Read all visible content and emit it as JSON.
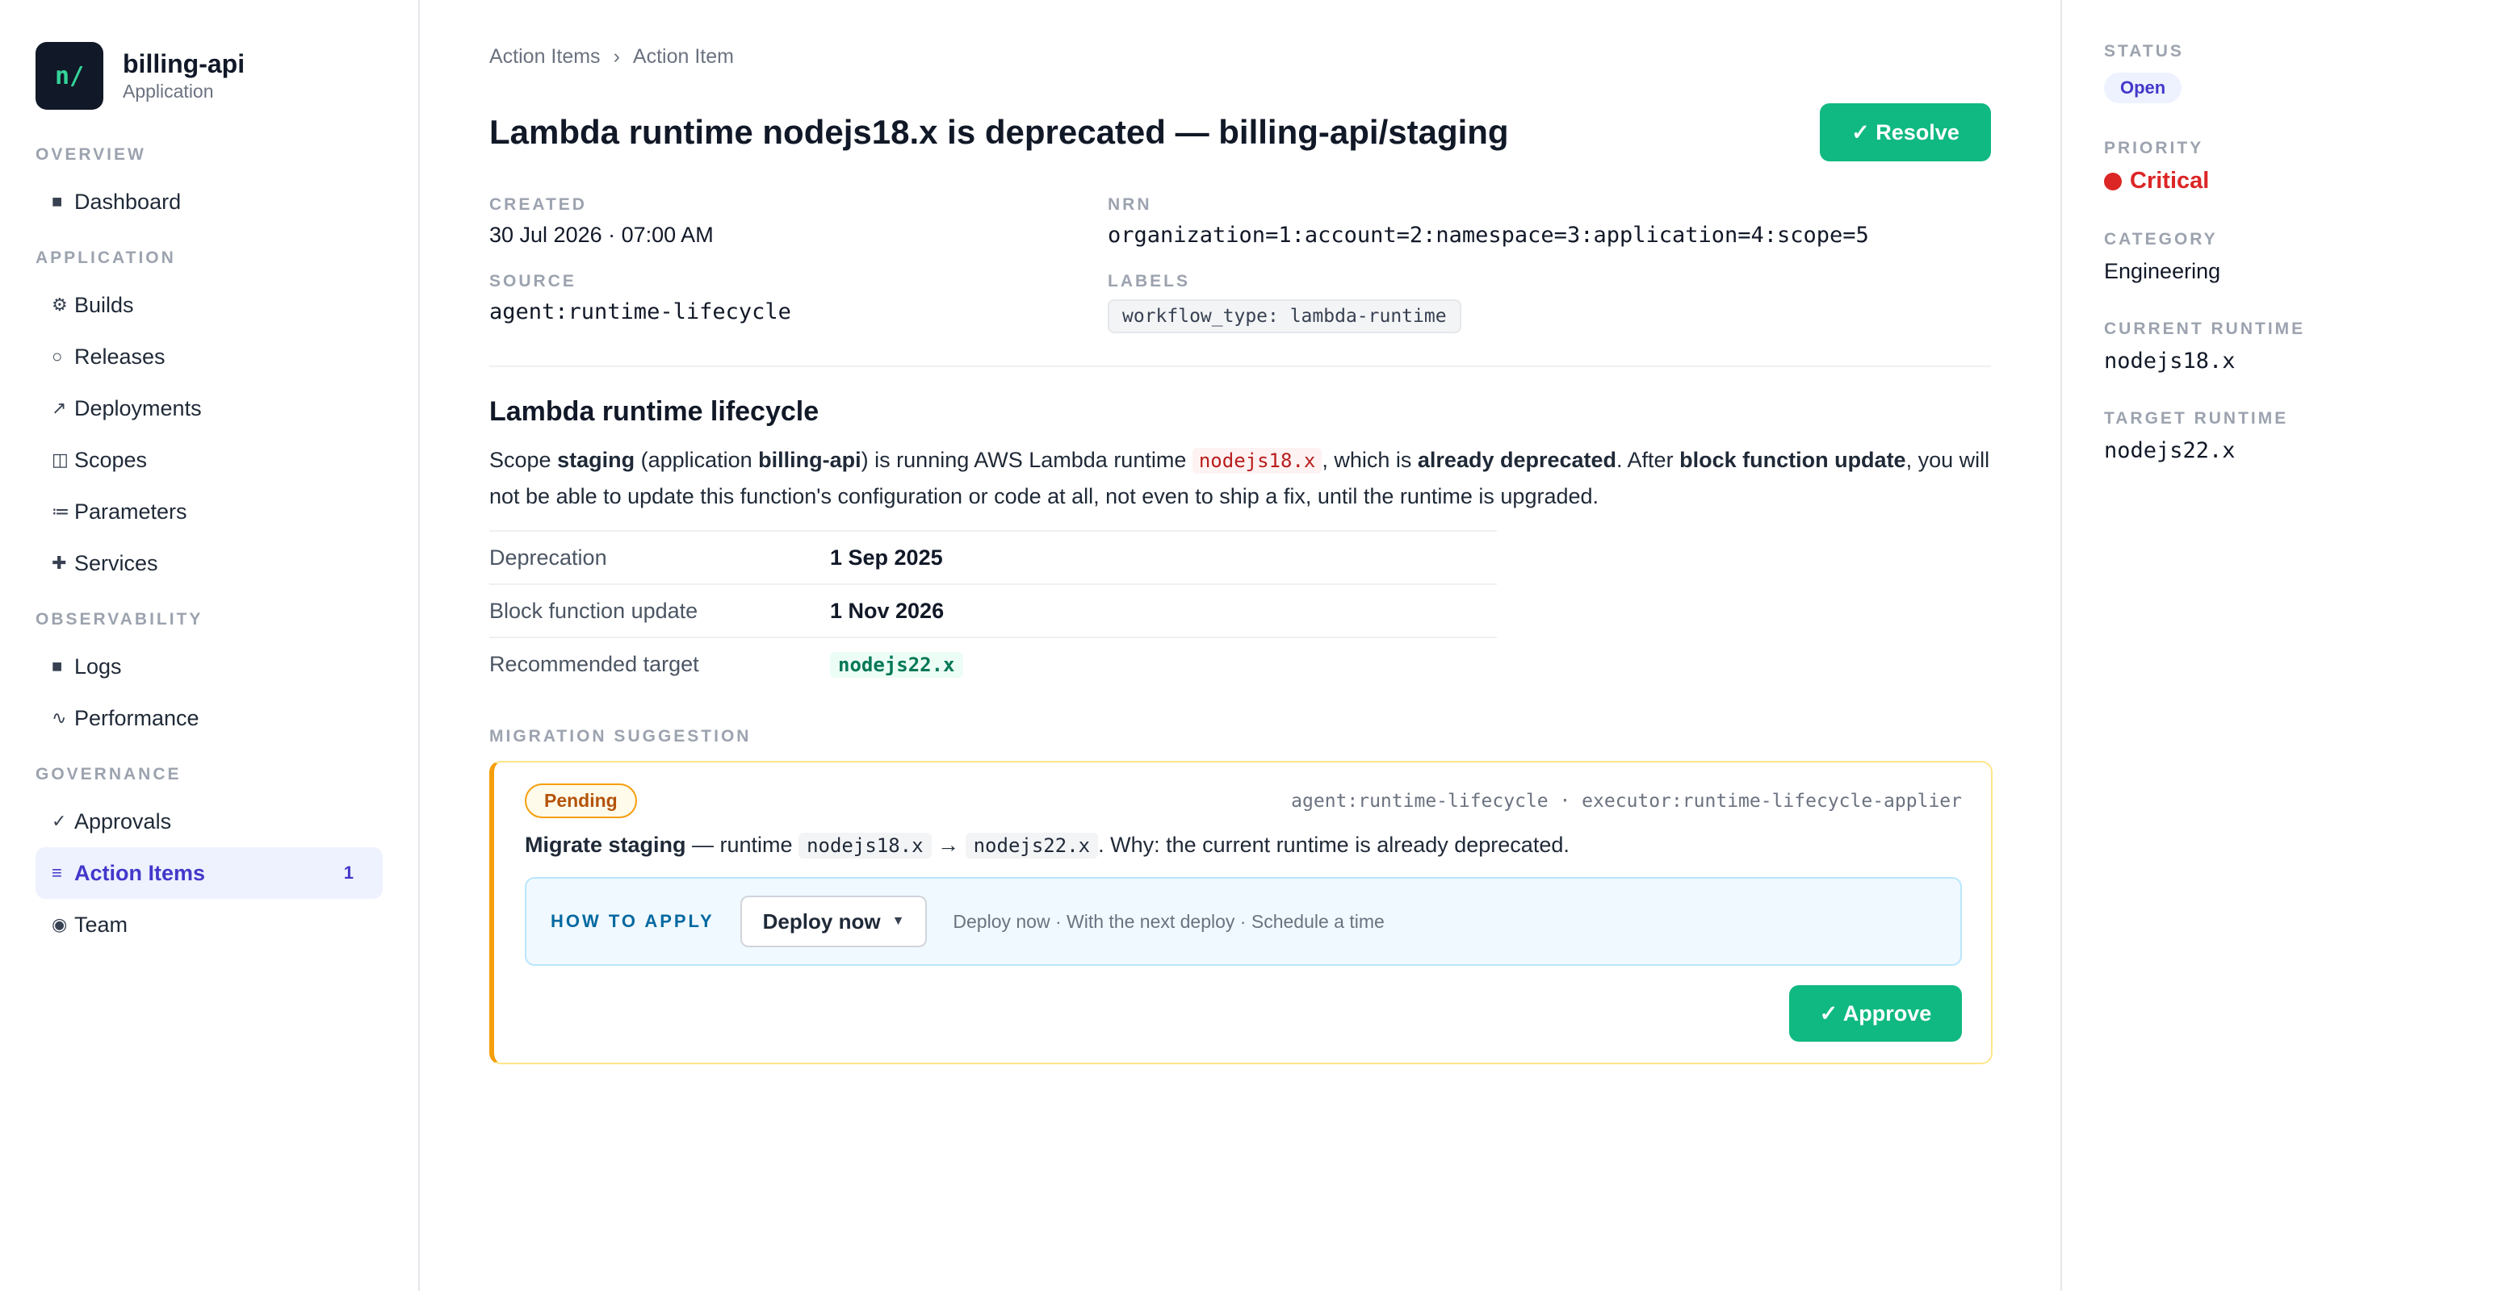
{
  "app": {
    "logo_text": "n/",
    "name": "billing-api",
    "subtitle": "Application"
  },
  "sidebar": {
    "sections": [
      {
        "title": "OVERVIEW",
        "items": [
          {
            "icon": "■",
            "label": "Dashboard"
          }
        ]
      },
      {
        "title": "APPLICATION",
        "items": [
          {
            "icon": "⚙",
            "label": "Builds"
          },
          {
            "icon": "○",
            "label": "Releases"
          },
          {
            "icon": "↗",
            "label": "Deployments"
          },
          {
            "icon": "◫",
            "label": "Scopes"
          },
          {
            "icon": "≔",
            "label": "Parameters"
          },
          {
            "icon": "✚",
            "label": "Services"
          }
        ]
      },
      {
        "title": "OBSERVABILITY",
        "items": [
          {
            "icon": "■",
            "label": "Logs"
          },
          {
            "icon": "∿",
            "label": "Performance"
          }
        ]
      },
      {
        "title": "GOVERNANCE",
        "items": [
          {
            "icon": "✓",
            "label": "Approvals"
          },
          {
            "icon": "≡",
            "label": "Action Items",
            "count": "1",
            "active": true
          },
          {
            "icon": "◉",
            "label": "Team"
          }
        ]
      }
    ]
  },
  "breadcrumb": {
    "parent": "Action Items",
    "separator": "›",
    "current": "Action Item"
  },
  "header": {
    "title": "Lambda runtime nodejs18.x is deprecated — billing-api/staging",
    "resolve_label": "✓ Resolve"
  },
  "meta": {
    "created_label": "CREATED",
    "created_value": "30 Jul 2026 · 07:00 AM",
    "nrn_label": "NRN",
    "nrn_value": "organization=1:account=2:namespace=3:application=4:scope=5",
    "source_label": "SOURCE",
    "source_value": "agent:runtime-lifecycle",
    "labels_label": "LABELS",
    "labels_value": "workflow_type: lambda-runtime"
  },
  "lifecycle": {
    "heading": "Lambda runtime lifecycle",
    "p_scope": "Scope ",
    "p_scope_name": "staging",
    "p_app_open": " (application ",
    "p_app_name": "billing-api",
    "p_running": ") is running AWS Lambda runtime ",
    "p_runtime": "nodejs18.x",
    "p_which": ", which is ",
    "p_deprecated": "already deprecated",
    "p_after": ". After ",
    "p_block": "block function update",
    "p_rest": ", you will not be able to update this function's configuration or code at all, not even to ship a fix, until the runtime is upgraded.",
    "rows": [
      {
        "label": "Deprecation",
        "value": "1 Sep 2025"
      },
      {
        "label": "Block function update",
        "value": "1 Nov 2026"
      },
      {
        "label": "Recommended target",
        "value": "nodejs22.x"
      }
    ]
  },
  "suggestion": {
    "section_label": "MIGRATION SUGGESTION",
    "status": "Pending",
    "agents": "agent:runtime-lifecycle · executor:runtime-lifecycle-applier",
    "bold": "Migrate staging",
    "dash": " — runtime ",
    "from": "nodejs18.x",
    "arrow": " → ",
    "to": "nodejs22.x",
    "why": ". Why: the current runtime is already deprecated.",
    "howto_label": "HOW TO APPLY",
    "select_value": "Deploy now",
    "options_text": "Deploy now · With the next deploy · Schedule a time",
    "approve_label": "✓ Approve"
  },
  "details": {
    "status_label": "STATUS",
    "status_value": "Open",
    "priority_label": "PRIORITY",
    "priority_value": "Critical",
    "category_label": "CATEGORY",
    "category_value": "Engineering",
    "current_runtime_label": "CURRENT RUNTIME",
    "current_runtime_value": "nodejs18.x",
    "target_runtime_label": "TARGET RUNTIME",
    "target_runtime_value": "nodejs22.x"
  },
  "colors": {
    "accent": "#10b981",
    "active_nav": "#4338ca",
    "critical": "#dc2626",
    "pending": "#f59e0b"
  }
}
